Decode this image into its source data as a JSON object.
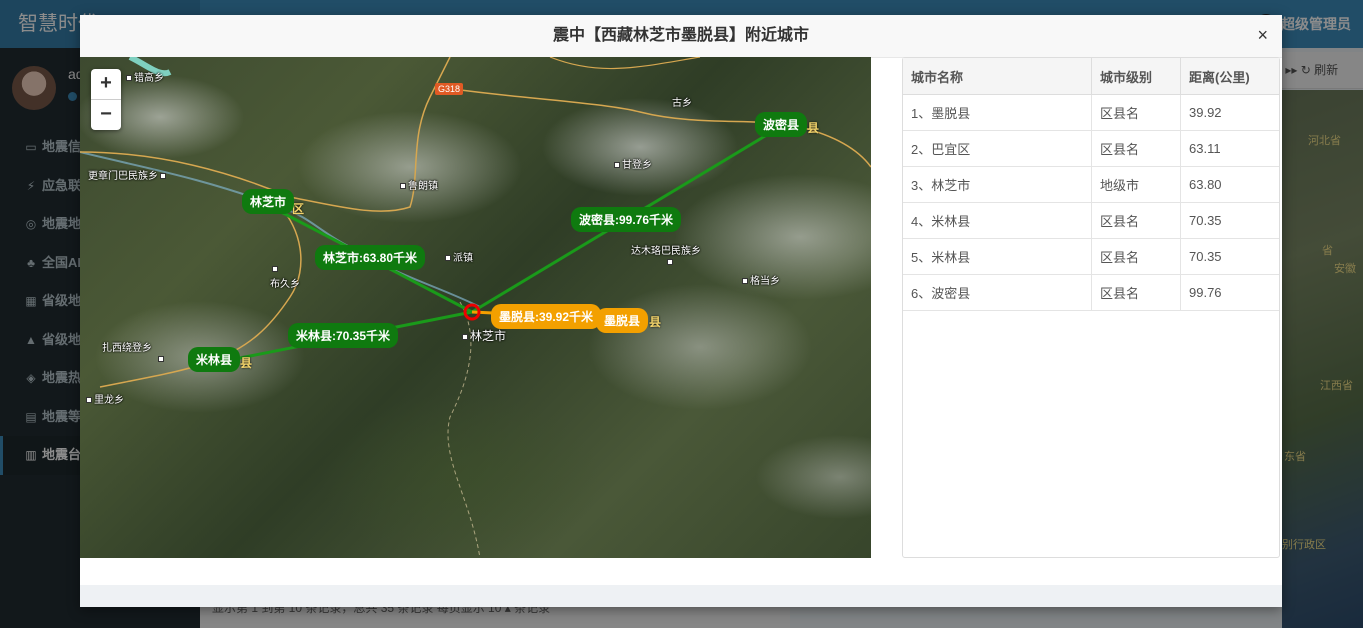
{
  "app": {
    "brand": "智慧时代",
    "admin_label": "超级管理员"
  },
  "sidebar": {
    "user_name": "admin",
    "items": [
      {
        "label": "地震信息",
        "icon": "▭"
      },
      {
        "label": "应急联动",
        "icon": "⚡"
      },
      {
        "label": "地震地图",
        "icon": "◎"
      },
      {
        "label": "全国AI",
        "icon": "♣"
      },
      {
        "label": "省级地震",
        "icon": "▦"
      },
      {
        "label": "省级地图",
        "icon": "▲"
      },
      {
        "label": "地震热力",
        "icon": "◈"
      },
      {
        "label": "地震等级",
        "icon": "▤"
      },
      {
        "label": "地震台",
        "icon": "▥"
      }
    ]
  },
  "background": {
    "refresh_label": "刷新",
    "footer_text": "显示第 1 到第 10 条记录，总共 35 条记录  每页显示 10 ▴ 条记录",
    "map_labels": [
      "河北省",
      "省",
      "安徽",
      "江西省",
      "东省",
      "别行政区"
    ]
  },
  "modal": {
    "title": "震中【西藏林芝市墨脱县】附近城市",
    "close_label": "×",
    "zoom_in": "+",
    "zoom_out": "−"
  },
  "map": {
    "epicenter_label": "墨脱县:39.92千米",
    "city_labels": [
      "林芝市",
      "米林县",
      "波密县",
      "墨脱县"
    ],
    "distance_labels": [
      "林芝市:63.80千米",
      "米林县:70.35千米",
      "波密县:99.76千米"
    ],
    "admin_suffix": [
      "区",
      "县",
      "县",
      "县"
    ],
    "road_badge": "G318",
    "pois": [
      "错高乡",
      "更章门巴民族乡",
      "鲁朗镇",
      "古乡",
      "甘登乡",
      "派镇",
      "布久乡",
      "达木珞巴民族乡",
      "格当乡",
      "林芝市",
      "扎西绕登乡",
      "里龙乡"
    ]
  },
  "table": {
    "headers": [
      "城市名称",
      "城市级别",
      "距离(公里)"
    ],
    "rows": [
      [
        "1、墨脱县",
        "区县名",
        "39.92"
      ],
      [
        "2、巴宜区",
        "区县名",
        "63.11"
      ],
      [
        "3、林芝市",
        "地级市",
        "63.80"
      ],
      [
        "4、米林县",
        "区县名",
        "70.35"
      ],
      [
        "5、米林县",
        "区县名",
        "70.35"
      ],
      [
        "6、波密县",
        "区县名",
        "99.76"
      ]
    ]
  }
}
